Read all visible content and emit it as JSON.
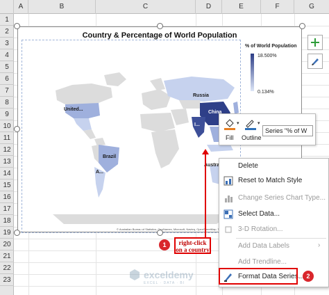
{
  "grid": {
    "columns": [
      "A",
      "B",
      "C",
      "D",
      "E",
      "F",
      "G"
    ],
    "rows": [
      "1",
      "2",
      "3",
      "4",
      "5",
      "6",
      "7",
      "8",
      "9",
      "10",
      "11",
      "12",
      "13",
      "14",
      "15",
      "16",
      "17",
      "18",
      "19",
      "20",
      "21",
      "22",
      "23"
    ]
  },
  "chart": {
    "title": "Country & Percentage of World Population",
    "legend_title": "% of World Population",
    "legend_max": "18.500%",
    "legend_min": "0.134%",
    "labels": {
      "united_states": "United...",
      "russia": "Russia",
      "china": "China",
      "india": "I...",
      "brazil": "Brazil",
      "argentina": "A...",
      "australia": "Australia"
    },
    "attribution": "© Australian Bureau of Statistics, GeoNames, Microsoft, Navteq, OpenStreetMap, TomTom, Wikipedia",
    "colors": {
      "china": "#2e3f88",
      "india": "#3d4f98",
      "high": "#6b7fc0",
      "mid": "#9fb0dd",
      "low": "#c6d2ee",
      "land": "#dcdcdc"
    }
  },
  "side_buttons": {
    "add_element": "chart-elements-icon",
    "style": "chart-styles-icon"
  },
  "mini_toolbar": {
    "fill_label": "Fill",
    "outline_label": "Outline",
    "series_value": "Series \"% of W"
  },
  "context_menu": {
    "items": [
      {
        "label": "Delete",
        "enabled": true
      },
      {
        "label": "Reset to Match Style",
        "enabled": true
      },
      {
        "label": "Change Series Chart Type...",
        "enabled": false
      },
      {
        "label": "Select Data...",
        "enabled": true
      },
      {
        "label": "3-D Rotation...",
        "enabled": false
      },
      {
        "label": "Add Data Labels",
        "enabled": false
      },
      {
        "label": "Add Trendline...",
        "enabled": false
      },
      {
        "label": "Format Data Series...",
        "enabled": true
      }
    ]
  },
  "callouts": {
    "step1_number": "1",
    "step1_text": "right-click on a country",
    "step2_number": "2"
  },
  "watermark": {
    "brand": "exceldemy",
    "tagline": "EXCEL · DATA · BI"
  }
}
